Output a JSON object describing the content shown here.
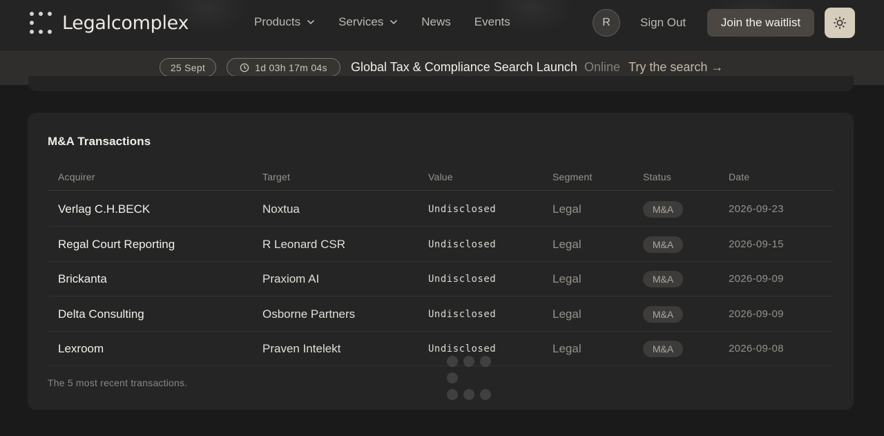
{
  "header": {
    "logo_text": "Legalcomplex",
    "nav": [
      {
        "label": "Products",
        "dropdown": true
      },
      {
        "label": "Services",
        "dropdown": true
      },
      {
        "label": "News",
        "dropdown": false
      },
      {
        "label": "Events",
        "dropdown": false
      }
    ],
    "avatar_initial": "R",
    "sign_out": "Sign Out",
    "cta": "Join the waitlist",
    "theme_icon": "sun-icon"
  },
  "announcement": {
    "date": "25 Sept",
    "countdown": "1d 03h 17m 04s",
    "title": "Global Tax & Compliance Search Launch",
    "status": "Online",
    "link": "Try the search →"
  },
  "transactions": {
    "title": "M&A Transactions",
    "columns": [
      "Acquirer",
      "Target",
      "Value",
      "Segment",
      "Status",
      "Date"
    ],
    "rows": [
      {
        "acquirer": "Verlag C.H.BECK",
        "target": "Noxtua",
        "value": "Undisclosed",
        "segment": "Legal",
        "status": "M&A",
        "date": "2026-09-23"
      },
      {
        "acquirer": "Regal Court Reporting",
        "target": "R Leonard CSR",
        "value": "Undisclosed",
        "segment": "Legal",
        "status": "M&A",
        "date": "2026-09-15"
      },
      {
        "acquirer": "Brickanta",
        "target": "Praxiom AI",
        "value": "Undisclosed",
        "segment": "Legal",
        "status": "M&A",
        "date": "2026-09-09"
      },
      {
        "acquirer": "Delta Consulting",
        "target": "Osborne Partners",
        "value": "Undisclosed",
        "segment": "Legal",
        "status": "M&A",
        "date": "2026-09-09"
      },
      {
        "acquirer": "Lexroom",
        "target": "Praven Intelekt",
        "value": "Undisclosed",
        "segment": "Legal",
        "status": "M&A",
        "date": "2026-09-08"
      }
    ],
    "footnote": "The 5 most recent transactions."
  },
  "colors": {
    "background": "#1a1a1a",
    "card": "#252525",
    "accent_button": "#4a4743",
    "theme_button": "#d7cdbd"
  }
}
